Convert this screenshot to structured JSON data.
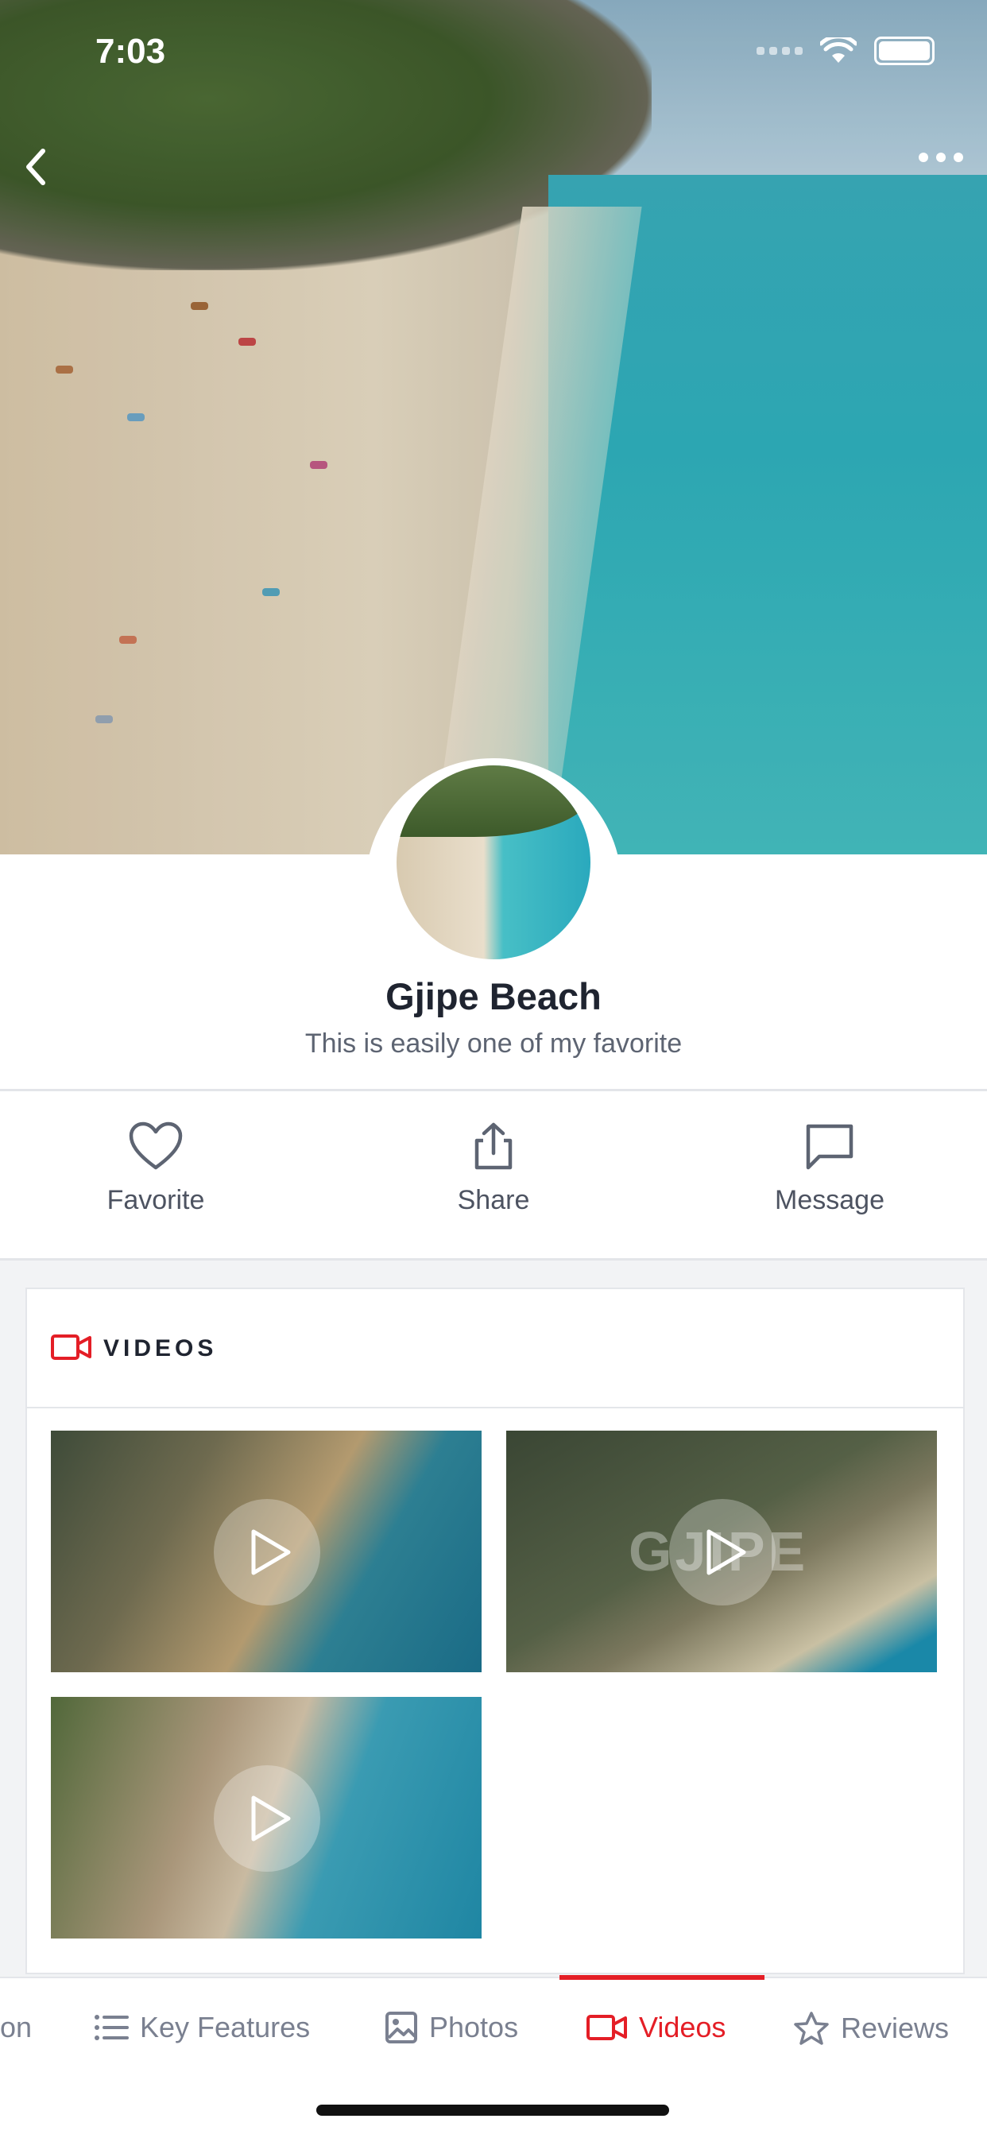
{
  "status": {
    "time": "7:03"
  },
  "place": {
    "name": "Gjipe Beach",
    "tagline": "This is easily one of my favorite"
  },
  "actions": [
    {
      "label": "Favorite",
      "icon": "heart-icon"
    },
    {
      "label": "Share",
      "icon": "share-icon"
    },
    {
      "label": "Message",
      "icon": "message-icon"
    }
  ],
  "videos": {
    "heading": "VIDEOS",
    "thumb2_overlay_text": "GJIPE"
  },
  "tabs": [
    {
      "label": "on",
      "icon": "",
      "active": false
    },
    {
      "label": "Key Features",
      "icon": "list-icon",
      "active": false
    },
    {
      "label": "Photos",
      "icon": "photo-icon",
      "active": false
    },
    {
      "label": "Videos",
      "icon": "video-icon",
      "active": true
    },
    {
      "label": "Reviews",
      "icon": "star-icon",
      "active": false
    }
  ],
  "colors": {
    "accent": "#e41e26",
    "text": "#1f2430",
    "muted": "#7a8090"
  }
}
